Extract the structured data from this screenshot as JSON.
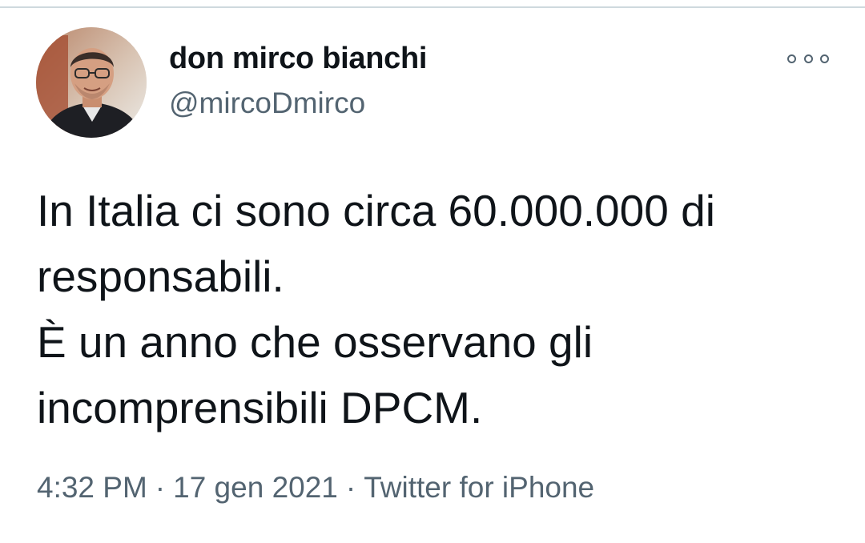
{
  "user": {
    "display_name": "don mirco bianchi",
    "handle": "@mircoDmirco",
    "avatar_icon": "profile-photo"
  },
  "menu": {
    "more_icon": "more-options-icon"
  },
  "tweet": {
    "lines": [
      "In Italia ci sono circa 60.000.000 di",
      "responsabili.",
      "È un anno che osservano gli",
      "incomprensibili DPCM."
    ]
  },
  "meta": {
    "time": "4:32 PM",
    "separator": "·",
    "date": "17 gen 2021",
    "source": "Twitter for iPhone"
  },
  "colors": {
    "primary_text": "#0f1419",
    "secondary_text": "#536471",
    "divider": "#cfd9de"
  }
}
